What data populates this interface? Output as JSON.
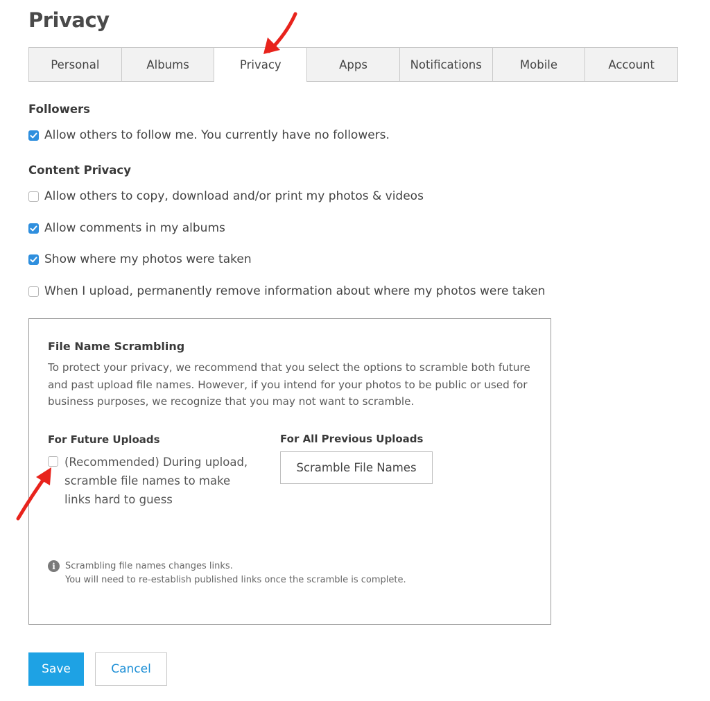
{
  "page": {
    "title": "Privacy"
  },
  "tabs": [
    {
      "label": "Personal",
      "active": false
    },
    {
      "label": "Albums",
      "active": false
    },
    {
      "label": "Privacy",
      "active": true
    },
    {
      "label": "Apps",
      "active": false
    },
    {
      "label": "Notifications",
      "active": false
    },
    {
      "label": "Mobile",
      "active": false
    },
    {
      "label": "Account",
      "active": false
    }
  ],
  "followers": {
    "heading": "Followers",
    "allow_follow": {
      "label": "Allow others to follow me. You currently have no followers.",
      "checked": true
    }
  },
  "content_privacy": {
    "heading": "Content Privacy",
    "options": [
      {
        "label": "Allow others to copy, download and/or print my photos & videos",
        "checked": false
      },
      {
        "label": "Allow comments in my albums",
        "checked": true
      },
      {
        "label": "Show where my photos were taken",
        "checked": true
      },
      {
        "label": "When I upload, permanently remove information about where my photos were taken",
        "checked": false
      }
    ]
  },
  "file_name_scrambling": {
    "title": "File Name Scrambling",
    "description": "To protect your privacy, we recommend that you select the options to scramble both future and past upload file names. However, if you intend for your photos to be public or used for business purposes, we recognize that you may not want to scramble.",
    "future_uploads": {
      "heading": "For Future Uploads",
      "option_label": "(Recommended) During upload, scramble file names to make links hard to guess",
      "checked": false
    },
    "previous_uploads": {
      "heading": "For All Previous Uploads",
      "button_label": "Scramble File Names"
    },
    "info": {
      "line1": "Scrambling file names changes links.",
      "line2": "You will need to re-establish published links once the scramble is complete."
    }
  },
  "actions": {
    "save_label": "Save",
    "cancel_label": "Cancel"
  },
  "colors": {
    "primary": "#1ea2e4",
    "checkbox_checked": "#2f8fde",
    "link": "#1d8fd6",
    "annotation_arrow": "#e8231c"
  },
  "icons": {
    "checkmark": "checkmark-icon",
    "info": "info-icon",
    "annotation": "red-arrow-annotation"
  }
}
